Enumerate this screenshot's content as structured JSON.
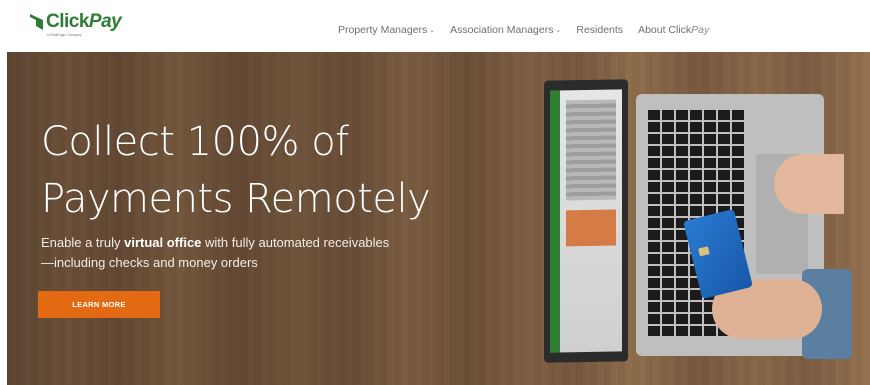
{
  "brand": {
    "name_part1": "Click",
    "name_part2": "Pay",
    "tagline": "A RealPage Company",
    "color": "#2e7d32"
  },
  "nav": {
    "items": [
      {
        "label": "Property Managers",
        "has_dropdown": true
      },
      {
        "label": "Association Managers",
        "has_dropdown": true
      },
      {
        "label": "Residents",
        "has_dropdown": false
      }
    ],
    "about_prefix": "About Click",
    "about_suffix": "Pay"
  },
  "hero": {
    "headline_line1": "Collect 100% of",
    "headline_line2": "Payments Remotely",
    "sub_prefix": "Enable a truly ",
    "sub_bold": "virtual office",
    "sub_line1_rest": " with fully automated receivables",
    "sub_line2": "—including checks and money orders",
    "cta_label": "LEARN MORE",
    "cta_color": "#e36a13"
  }
}
